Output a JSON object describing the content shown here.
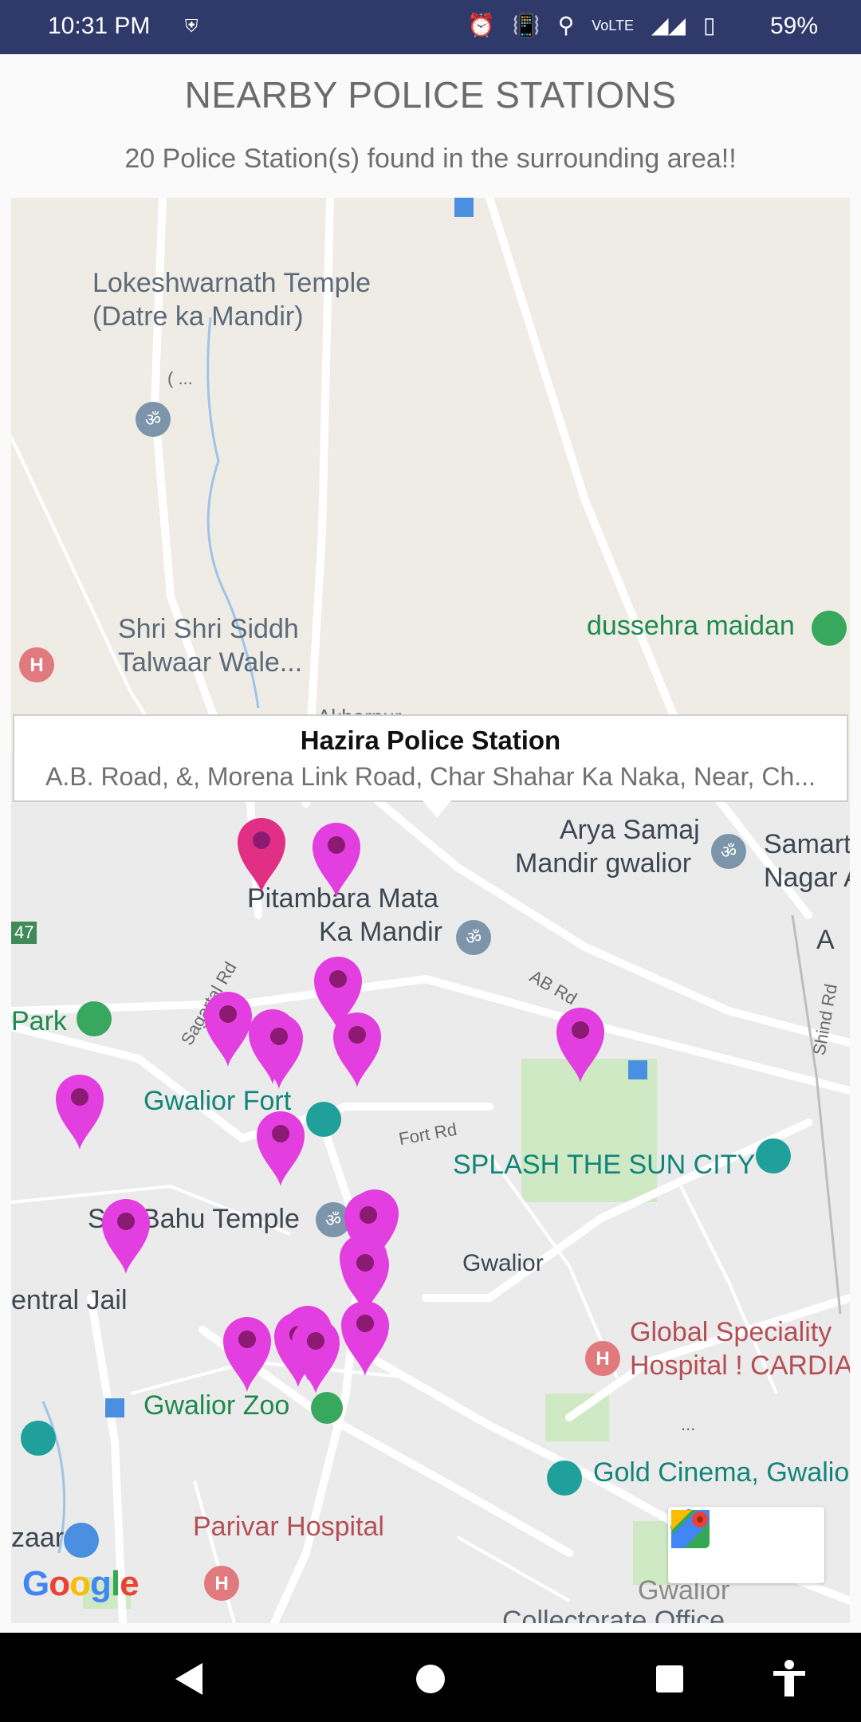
{
  "status_bar": {
    "time": "10:31 PM",
    "battery": "59%",
    "icons": [
      "shield-icon",
      "alarm-icon",
      "vibrate-icon",
      "location-icon",
      "volte-icon",
      "signal-icon",
      "battery-icon"
    ]
  },
  "header": {
    "title": "NEARBY POLICE STATIONS",
    "subtitle": "20 Police Station(s) found in the surrounding area!!"
  },
  "map": {
    "labels": {
      "temple1_line1": "Lokeshwarnath Temple",
      "temple1_line2": "(Datre ka Mandir)",
      "ellipsis1": "( ...",
      "siddh_line1": "Shri Shri Siddh",
      "siddh_line2": "Talwaar Wale...",
      "dussehra": "dussehra maidan",
      "akbarpur": "Akbarpur",
      "arya_line1": "Arya Samaj",
      "arya_line2": "Mandir gwalior",
      "samart_line1": "Samart",
      "samart_line2": "Nagar A",
      "pitambara_line1": "Pitambara Mata",
      "pitambara_line2": "Ka Mandir",
      "nh47": "47",
      "sagartal": "Sagartal Rd",
      "abrd": "AB Rd",
      "a": "A",
      "shind": "Shind Rd",
      "park": "Park",
      "fort": "Gwalior Fort",
      "fortrd": "Fort Rd",
      "splash": "SPLASH THE SUN CITY",
      "sasbahu": "Sas Bahu Temple",
      "gwalior": "Gwalior",
      "jail": "entral Jail",
      "global_line1": "Global Speciality",
      "global_line2": "Hospital ! CARDIA",
      "zoo": "Gwalior Zoo",
      "gold": "Gold Cinema, Gwalio",
      "ellipsis2": "...",
      "parivar": "Parivar Hospital",
      "bazaar": "zaar",
      "gwalior2": "Gwalior",
      "collectorate": "Collectorate Office",
      "google": "Google"
    },
    "info_window": {
      "name": "Hazira Police Station",
      "address": "A.B. Road, &, Morena Link Road, Char Shahar Ka Naka, Near, Ch..."
    },
    "colors": {
      "pin": "#e23ee0",
      "pin_selected": "#e12f86",
      "pin_dot": "#8b1a73"
    }
  },
  "nav": [
    "back-button",
    "home-button",
    "recents-button",
    "accessibility-button"
  ]
}
